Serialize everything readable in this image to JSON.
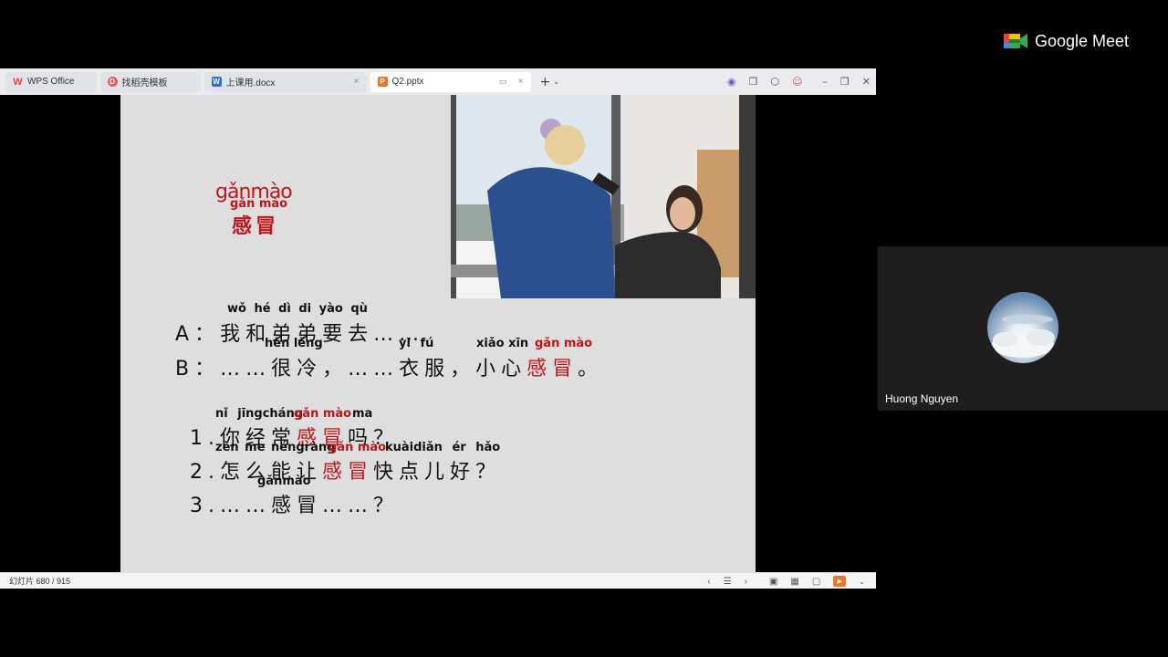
{
  "app": {
    "meet_label": "Google Meet"
  },
  "tabs": [
    {
      "label": "WPS Office",
      "icon": "wps-logo-icon",
      "color": "#e74c3c"
    },
    {
      "label": "找稻壳模板",
      "icon": "docer-icon",
      "color": "#e55b5b"
    },
    {
      "label": "上课用.docx",
      "icon": "word-doc-icon",
      "color": "#2f6fd6"
    },
    {
      "label": "Q2.pptx",
      "icon": "ppt-icon",
      "color": "#e8772e"
    }
  ],
  "status": {
    "slide_counter": "幻灯片 680 / 915"
  },
  "participant": {
    "name": "Huong Nguyen"
  },
  "slide": {
    "title_pinyin_tone": "gǎnmào",
    "title_pinyin": "gǎn mào",
    "title_hanzi": "感冒",
    "lineA": {
      "pinyin": "wǒ hé dì di yào qù",
      "label": "A：",
      "text": "我和弟弟要去……"
    },
    "lineB": {
      "pinyin1": "hěn lěng",
      "pinyin2": "yī fú",
      "pinyin3": "xiǎo xīn",
      "pinyin4": "gǎn mào",
      "label": "B：",
      "text1": "……很冷，……衣服，小心",
      "red": "感冒",
      "end": "。"
    },
    "q1": {
      "pinyin": "nǐ jīngcháng",
      "pinyin_red": "gǎn mào",
      "pinyin_end": "ma",
      "pre": "1.你经常",
      "red": "感冒",
      "post": "吗？"
    },
    "q2": {
      "pinyin": "zěn me néngràng",
      "pinyin_red": "gǎn mào",
      "pinyin_end": "kuàidiǎn ér hǎo",
      "pre": "2.怎么能让",
      "red": "感冒",
      "post": "快点儿好？"
    },
    "q3": {
      "pinyin": "gǎnmào",
      "text": "3.……感冒……？"
    }
  }
}
